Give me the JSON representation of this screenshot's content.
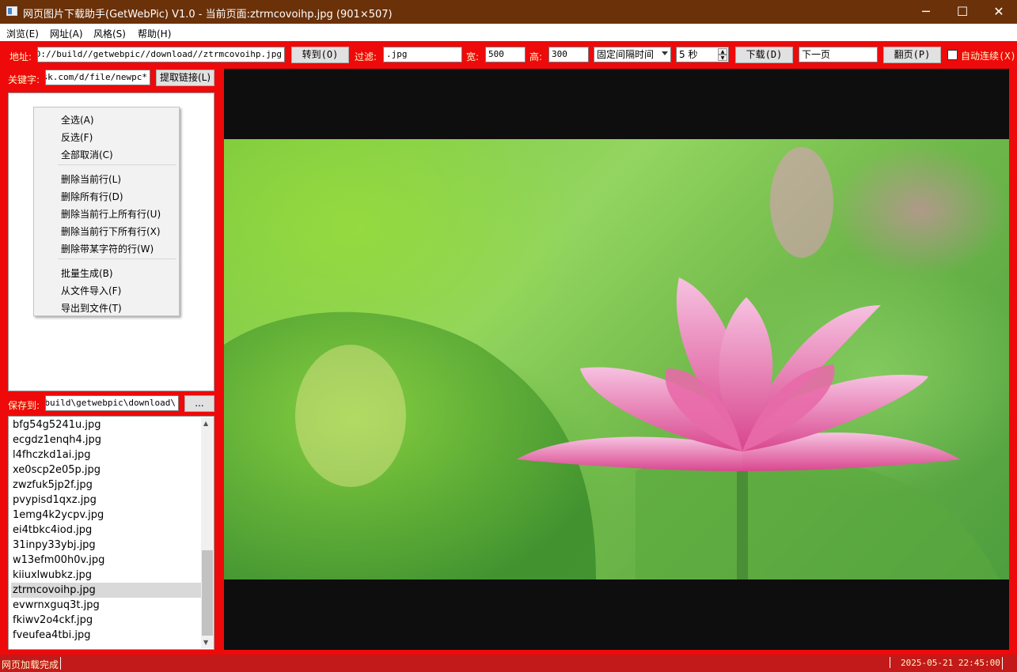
{
  "window": {
    "title": "网页图片下载助手(GetWebPic) V1.0 - 当前页面:ztrmcovoihp.jpg (901×507)",
    "min_glyph": "─",
    "max_glyph": "☐",
    "close_glyph": "✕"
  },
  "menu": {
    "items": [
      {
        "label": "浏览(E)"
      },
      {
        "label": "网址(A)"
      },
      {
        "label": "风格(S)"
      },
      {
        "label": "帮助(H)"
      }
    ]
  },
  "toolbar": {
    "address_label": "地址:",
    "address_value": "file:///D://build//getwebpic//download//ztrmcovoihp.jpg",
    "goto_button": "转到(O)",
    "filter_label": "过滤:",
    "filter_value": ".jpg",
    "width_label": "宽:",
    "width_value": "500",
    "height_label": "高:",
    "height_value": "300",
    "interval_mode": "固定间隔时间",
    "interval_value": "5 秒",
    "download_button": "下载(D)",
    "next_page_value": "下一页",
    "page_button": "翻页(P)",
    "auto_continue_label": "自动连续(X)",
    "auto_continue_checked": false
  },
  "keyword": {
    "label": "关键字:",
    "value": "desk.com/d/file/newpc*",
    "extract_button": "提取链接(L)"
  },
  "context_menu": {
    "group1": [
      "全选(A)",
      "反选(F)",
      "全部取消(C)"
    ],
    "group2": [
      "删除当前行(L)",
      "删除所有行(D)",
      "删除当前行上所有行(U)",
      "删除当前行下所有行(X)",
      "删除带某字符的行(W)"
    ],
    "group3": [
      "批量生成(B)",
      "从文件导入(F)",
      "导出到文件(T)"
    ]
  },
  "save": {
    "label": "保存到:",
    "path": "D:\\build\\getwebpic\\download\\",
    "browse_button": "..."
  },
  "files": {
    "items": [
      "bfg54g5241u.jpg",
      "ecgdz1enqh4.jpg",
      "l4fhczkd1ai.jpg",
      "xe0scp2e05p.jpg",
      "zwzfuk5jp2f.jpg",
      "pvypisd1qxz.jpg",
      "1emg4k2ycpv.jpg",
      "ei4tbkc4iod.jpg",
      "31inpy33ybj.jpg",
      "w13efm00h0v.jpg",
      "kiiuxlwubkz.jpg",
      "ztrmcovoihp.jpg",
      "evwrnxguq3t.jpg",
      "fkiwv2o4ckf.jpg",
      "fveufea4tbi.jpg"
    ],
    "selected": "ztrmcovoihp.jpg",
    "scroll_up": "▲",
    "scroll_down": "▼"
  },
  "viewer": {
    "image": "lotus-flower-photo"
  },
  "status": {
    "message": "网页加载完成",
    "datetime": "2025-05-21 22:45:00"
  },
  "colors": {
    "title_bg": "#6b3109",
    "workspace_bg": "#ee0a0a",
    "label_text": "#fff6c8",
    "viewer_bg": "#0e0e0e",
    "status_bg": "#c21a1a"
  }
}
